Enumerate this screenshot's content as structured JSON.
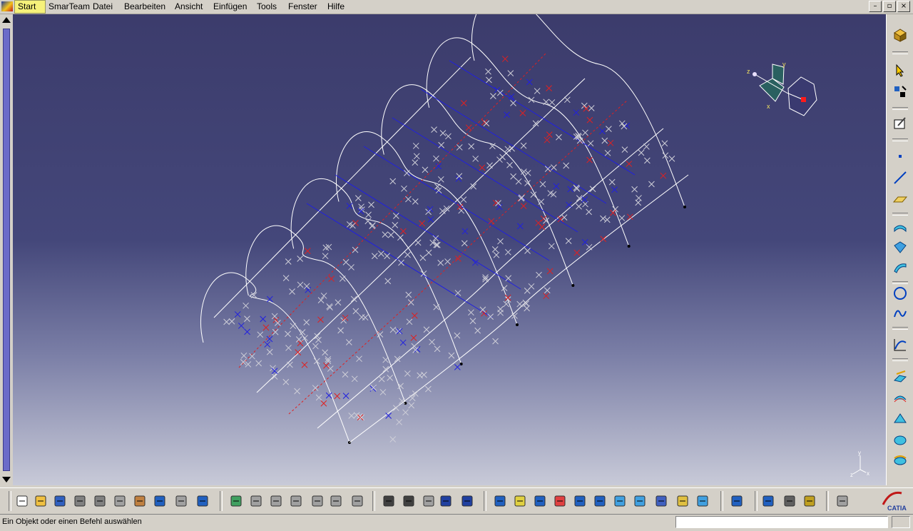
{
  "menubar": {
    "items": [
      "Start",
      "SmarTeam",
      "Datei",
      "Bearbeiten",
      "Ansicht",
      "Einfügen",
      "Tools",
      "Fenster",
      "Hilfe"
    ],
    "window_buttons": [
      "–",
      "▫",
      "×"
    ]
  },
  "compass": {
    "axis_x": "x",
    "axis_y": "y",
    "axis_z": "z"
  },
  "axis_indicator": {
    "y": "y",
    "x": "x",
    "z": "z"
  },
  "bottom_toolbar": {
    "tools": [
      "new-file-icon",
      "open-file-icon",
      "save-icon",
      "print-icon",
      "cut-icon",
      "copy-icon",
      "paste-icon",
      "undo-icon",
      "redo-icon",
      "whats-this-icon",
      "update-icon",
      "measure-icon",
      "hide-icon",
      "swap-icon",
      "grid-icon",
      "analysis-icon",
      "tree-icon",
      "formula-icon",
      "knowledge-icon",
      "light-icon",
      "table-icon",
      "graph-icon",
      "fly-icon",
      "fit-all-icon",
      "pan-icon",
      "rotate-icon",
      "zoom-in-icon",
      "zoom-out-icon",
      "normal-view-icon",
      "iso-view-icon",
      "shading-icon",
      "hide-show-icon",
      "swap-visible-icon",
      "snap-icon",
      "measure-distance-icon",
      "inertia-icon",
      "weight-icon",
      "spin-icon"
    ],
    "logo_text": "CATIA"
  },
  "status": {
    "text": "Ein Objekt oder einen Befehl auswählen",
    "input_value": ""
  },
  "colors": {
    "viewport_top": "#3c3c6c",
    "viewport_bottom": "#c8cad8",
    "curve_white": "#ffffff",
    "curve_red": "#e02020",
    "curve_blue": "#2020e0",
    "cross_grey": "#cfcfd8"
  }
}
